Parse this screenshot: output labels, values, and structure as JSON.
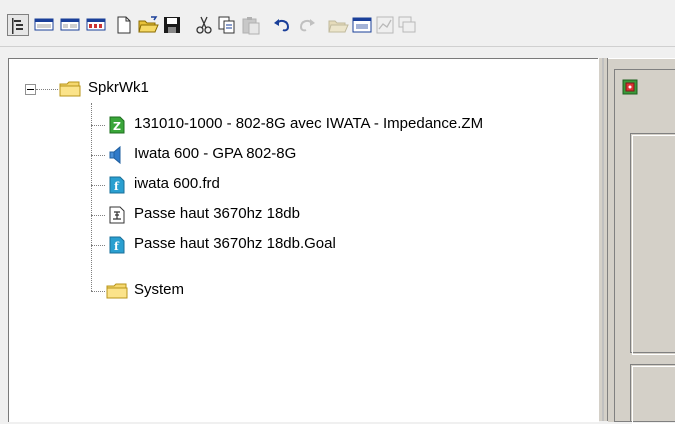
{
  "toolbar": {
    "buttons": [
      {
        "icon": "tree-view-icon",
        "state": "pressed"
      },
      {
        "icon": "panel-view-1-icon",
        "state": "normal"
      },
      {
        "icon": "panel-view-2-icon",
        "state": "normal"
      },
      {
        "icon": "panel-view-3-icon",
        "state": "normal"
      },
      {
        "icon": "new-document-icon",
        "state": "normal"
      },
      {
        "icon": "open-folder-icon",
        "state": "normal"
      },
      {
        "icon": "save-icon",
        "state": "normal"
      },
      {
        "icon": "cut-icon",
        "state": "normal"
      },
      {
        "icon": "copy-icon",
        "state": "normal"
      },
      {
        "icon": "paste-icon",
        "state": "disabled"
      },
      {
        "icon": "undo-icon",
        "state": "normal"
      },
      {
        "icon": "redo-icon",
        "state": "disabled"
      },
      {
        "icon": "open-folder-2-icon",
        "state": "disabled"
      },
      {
        "icon": "window-icon",
        "state": "normal"
      },
      {
        "icon": "graph-icon",
        "state": "disabled"
      },
      {
        "icon": "multi-window-icon",
        "state": "disabled"
      }
    ]
  },
  "tree": {
    "root": {
      "label": "SpkrWk1",
      "icon": "folder-icon",
      "expanded": true
    },
    "items": [
      {
        "label": "131010-1000 - 802-8G avec IWATA - Impedance.ZM",
        "icon": "impedance-file-icon"
      },
      {
        "label": "Iwata 600 - GPA 802-8G",
        "icon": "speaker-icon"
      },
      {
        "label": "iwata 600.frd",
        "icon": "frequency-file-icon"
      },
      {
        "label": "Passe haut 3670hz 18db",
        "icon": "filter-circuit-icon"
      },
      {
        "label": "Passe haut 3670hz 18db.Goal",
        "icon": "goal-file-icon"
      },
      {
        "label": "System",
        "icon": "folder-icon"
      }
    ]
  },
  "colors": {
    "toolbar_bg": "#f0f0f0",
    "folder": "#f5d76e",
    "file_green": "#3aa63a",
    "file_teal": "#2a9fd0",
    "speaker": "#4a90d9",
    "pane_bg": "#d4d0c8"
  }
}
